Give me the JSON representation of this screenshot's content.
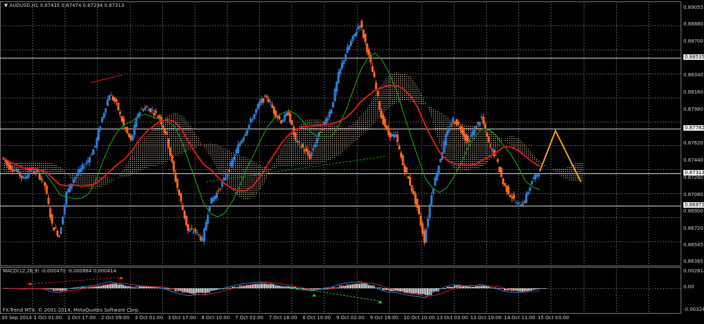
{
  "header": {
    "symbol": "AUDUSD,H1",
    "ohlc": "0.87415 0.87474 0.87234 0.87313",
    "macd_title": "MACD(12,26,9) -0.000470 -0.000884 0.000414",
    "watermark": "FX-Trend MT4, © 2001-2014, MetaQuotes Software Corp."
  },
  "price_axis": {
    "labels": [
      "0.89055",
      "0.88880",
      "0.88700",
      "0.88535",
      "0.88340",
      "0.88160",
      "0.87980",
      "0.87782",
      "0.87620",
      "0.87440",
      "0.87313",
      "0.87260",
      "0.87080",
      "0.86972",
      "0.86900",
      "0.86720",
      "0.86545",
      "0.86365"
    ],
    "highlighted": [
      {
        "text": "0.88535",
        "style": "white"
      },
      {
        "text": "0.87782",
        "style": "white"
      },
      {
        "text": "0.87313",
        "style": "white"
      },
      {
        "text": "0.86972",
        "style": "white"
      }
    ]
  },
  "macd_axis": {
    "labels": [
      "0.002814",
      "0.00",
      "-0.003242"
    ]
  },
  "time_axis": {
    "labels": [
      "30 Sep 2014",
      "1 Oct 01:00",
      "1 Oct 17:00",
      "2 Oct 09:00",
      "3 Oct 01:00",
      "3 Oct 17:00",
      "6 Oct 10:00",
      "7 Oct 02:00",
      "7 Oct 18:00",
      "8 Oct 10:00",
      "9 Oct 02:00",
      "9 Oct 18:00",
      "10 Oct 10:00",
      "13 Oct 03:00",
      "13 Oct 19:00",
      "14 Oct 11:00",
      "15 Oct 03:00"
    ]
  },
  "colors": {
    "background": "#000000",
    "grid": "#5a5a5a",
    "bull": "#2f7ed8",
    "bear": "#ff6a1f",
    "ma_red": "#e01b1b",
    "ma_green": "#1d9a1d",
    "cloud_light": "#f2d9c0",
    "cloud_dark": "#8a6a55",
    "projection": "#ffa020",
    "macd_hist": "#d8d8d8",
    "macd_signal_red": "#e01b1b",
    "macd_main_blue": "#2f7ed8"
  },
  "chart_data": {
    "type": "candlestick",
    "symbol": "AUDUSD",
    "timeframe": "H1",
    "ylim": [
      0.86365,
      0.89055
    ],
    "horizontal_levels": [
      0.88535,
      0.87782,
      0.87313,
      0.86972
    ],
    "close_path_approx": [
      0.8748,
      0.8738,
      0.8734,
      0.8725,
      0.8735,
      0.8731,
      0.8718,
      0.8676,
      0.8665,
      0.871,
      0.8725,
      0.8735,
      0.8745,
      0.876,
      0.879,
      0.8815,
      0.8804,
      0.8781,
      0.8765,
      0.8795,
      0.8801,
      0.8797,
      0.879,
      0.877,
      0.8732,
      0.87,
      0.867,
      0.867,
      0.866,
      0.87,
      0.871,
      0.8724,
      0.874,
      0.876,
      0.8775,
      0.879,
      0.8806,
      0.8812,
      0.8796,
      0.8786,
      0.8795,
      0.8765,
      0.8758,
      0.8748,
      0.8768,
      0.8784,
      0.88,
      0.8835,
      0.8858,
      0.8874,
      0.889,
      0.8862,
      0.883,
      0.879,
      0.8772,
      0.877,
      0.874,
      0.872,
      0.8695,
      0.866,
      0.871,
      0.874,
      0.877,
      0.8788,
      0.878,
      0.8764,
      0.8778,
      0.879,
      0.8762,
      0.8748,
      0.872,
      0.8708,
      0.8698,
      0.8702,
      0.8723,
      0.8733
    ],
    "projection": [
      [
        0.8733
      ],
      [
        0.8776
      ],
      [
        0.8722
      ]
    ],
    "macd": {
      "main": -0.00047,
      "signal": -0.000884,
      "histogram": 0.000414
    }
  }
}
